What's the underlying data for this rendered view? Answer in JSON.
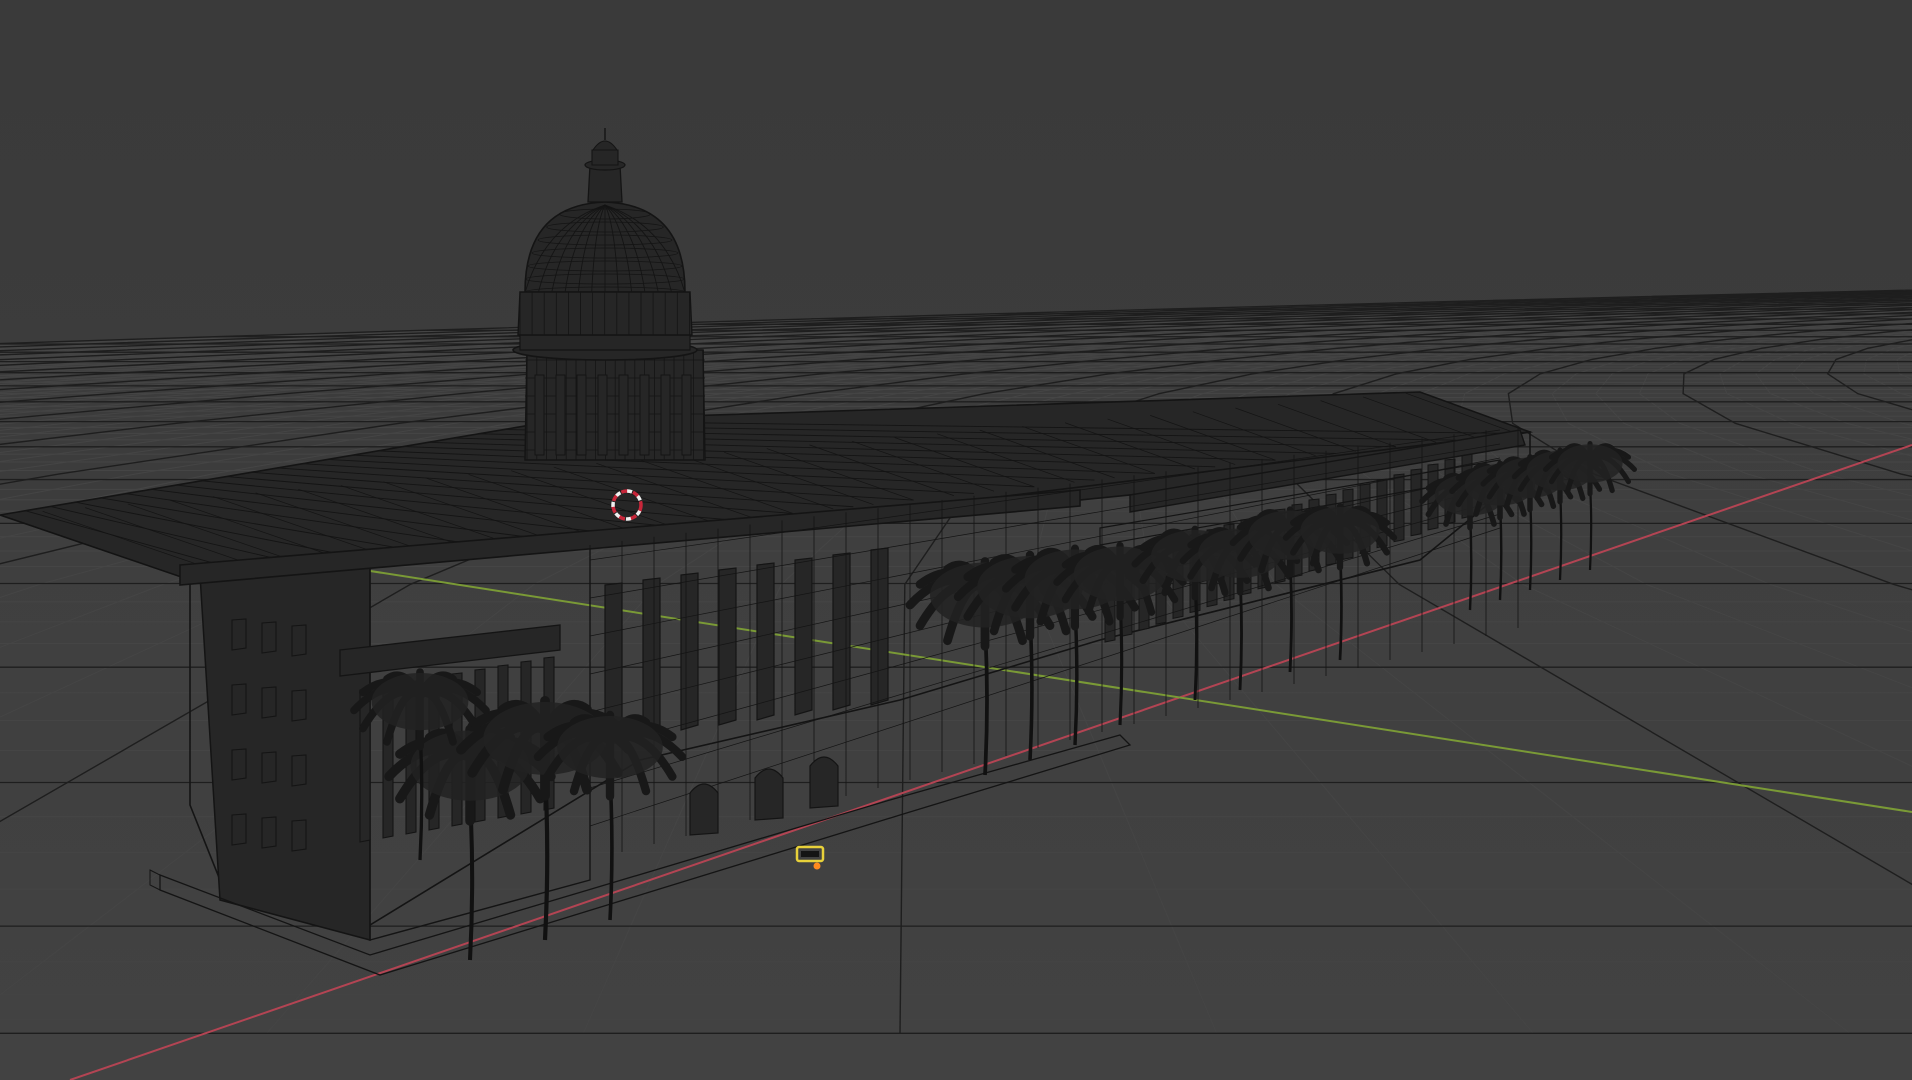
{
  "app": {
    "editor": "3D Viewport",
    "shading": "wireframe"
  },
  "scene": {
    "objects": [
      "dome-building",
      "palm-trees",
      "camera",
      "3d-cursor"
    ]
  },
  "colors": {
    "background": "#3b3b3b",
    "grid_minor": "#454545",
    "grid_major": "#1e1e1e",
    "wire": "#141414",
    "mesh_fill": "#262626",
    "x_axis": "#b34453",
    "y_axis": "#7a9a36",
    "cursor_red": "#c8263a",
    "cursor_white": "#f0f0f0",
    "camera_yellow": "#e8d13a",
    "origin_orange": "#ff8a1e"
  }
}
